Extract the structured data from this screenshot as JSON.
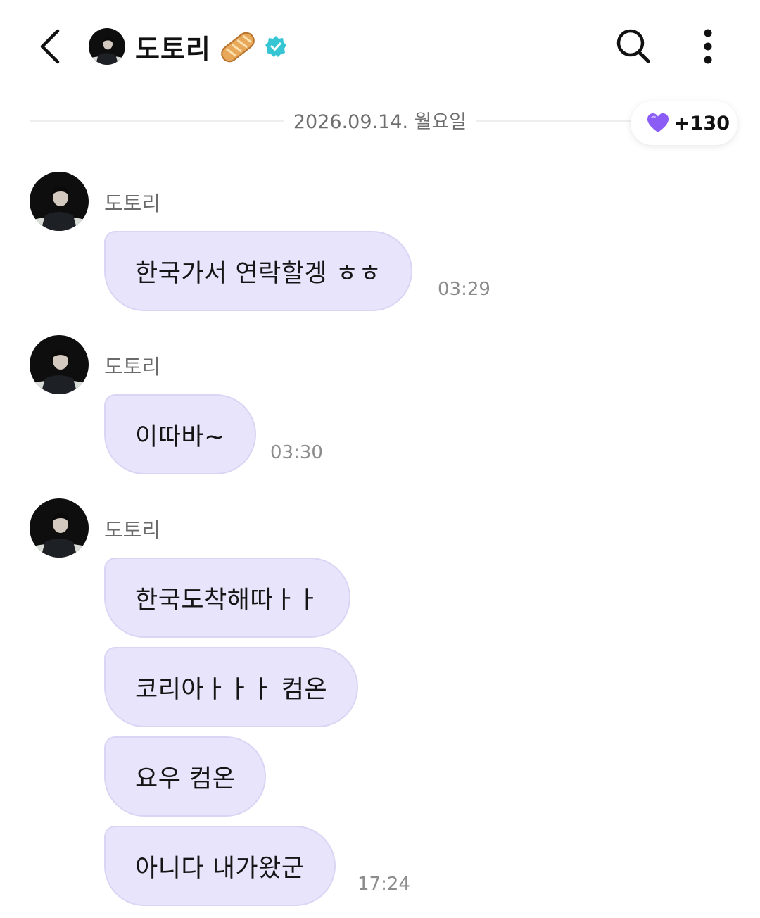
{
  "header": {
    "title": "도토리",
    "back_icon": "chevron-left-icon",
    "bread_icon": "baguette-icon",
    "verified_icon": "verified-badge-icon",
    "search_icon": "search-icon",
    "more_icon": "more-vertical-icon"
  },
  "date_divider": {
    "label": "2026.09.14. 월요일"
  },
  "likes": {
    "icon": "purple-heart-icon",
    "count": "+130",
    "color": "#8b5cf6"
  },
  "colors": {
    "bubble_bg": "#e7e4fb",
    "bubble_border": "#d9d5f4",
    "verified": "#36c6d3"
  },
  "messages": [
    {
      "sender": "도토리",
      "bubbles": [
        "한국가서 연락할겡 ㅎㅎ"
      ],
      "time": "03:29"
    },
    {
      "sender": "도토리",
      "bubbles": [
        "이따바~"
      ],
      "time": "03:30"
    },
    {
      "sender": "도토리",
      "bubbles": [
        "한국도착해따ㅏㅏ",
        "코리아ㅏㅏㅏ 컴온",
        "요우 컴온",
        "아니다 내가왔군"
      ],
      "time": "17:24"
    }
  ]
}
